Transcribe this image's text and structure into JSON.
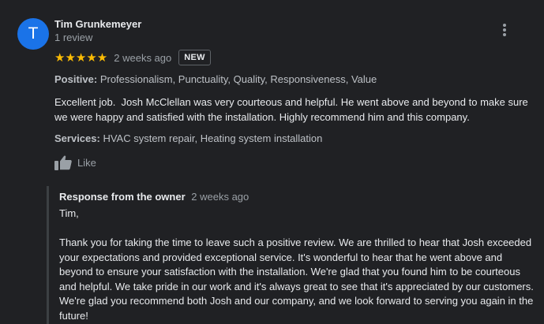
{
  "reviewer": {
    "initial": "T",
    "name": "Tim Grunkemeyer",
    "review_count": "1 review",
    "avatar_color": "#1a73e8"
  },
  "review": {
    "stars": "★★★★★",
    "rating": 5,
    "date": "2 weeks ago",
    "badge": "NEW",
    "positive_label": "Positive:",
    "positive_values": "Professionalism, Punctuality, Quality, Responsiveness, Value",
    "text": "Excellent job.  Josh McClellan was very courteous and helpful. He went above and beyond to make sure we were happy and satisfied with the installation. Highly recommend him and this company.",
    "services_label": "Services:",
    "services_values": "HVAC system repair, Heating system installation",
    "like_label": "Like"
  },
  "owner_response": {
    "title": "Response from the owner",
    "date": "2 weeks ago",
    "text": "Tim,\n\nThank you for taking the time to leave such a positive review. We are thrilled to hear that Josh exceeded your expectations and provided exceptional service. It's wonderful to hear that he went above and beyond to ensure your satisfaction with the installation. We're glad that you found him to be courteous and helpful. We take pride in our work and it's always great to see that it's appreciated by our customers. We're glad you recommend both Josh and our company, and we look forward to serving you again in the future!"
  },
  "icons": {
    "more": "more-vert-icon",
    "like": "thumb-up-icon",
    "star": "star-icon"
  },
  "colors": {
    "background": "#202124",
    "star": "#fbbc04",
    "text_primary": "#e8eaed",
    "text_secondary": "#9aa0a6"
  }
}
